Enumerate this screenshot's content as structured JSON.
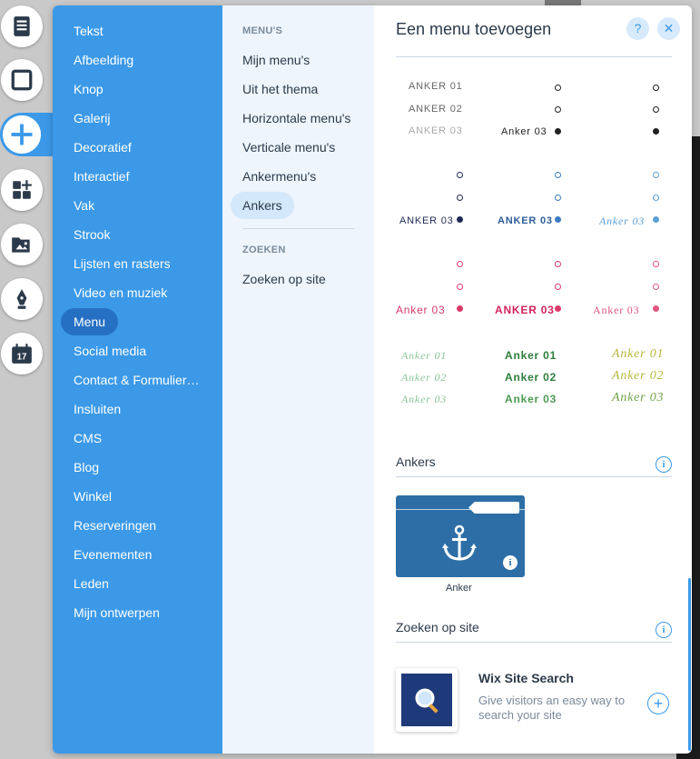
{
  "rail": {
    "items": [
      {
        "icon": "pages-icon"
      },
      {
        "icon": "frame-icon"
      },
      {
        "icon": "add-icon"
      },
      {
        "icon": "apps-icon"
      },
      {
        "icon": "media-icon"
      },
      {
        "icon": "pen-icon"
      },
      {
        "icon": "calendar-icon",
        "badge": "17"
      }
    ]
  },
  "categories": [
    {
      "label": "Tekst"
    },
    {
      "label": "Afbeelding"
    },
    {
      "label": "Knop"
    },
    {
      "label": "Galerij"
    },
    {
      "label": "Decoratief"
    },
    {
      "label": "Interactief"
    },
    {
      "label": "Vak"
    },
    {
      "label": "Strook"
    },
    {
      "label": "Lijsten en rasters"
    },
    {
      "label": "Video en muziek"
    },
    {
      "label": "Menu"
    },
    {
      "label": "Social media"
    },
    {
      "label": "Contact & Formulier…"
    },
    {
      "label": "Insluiten"
    },
    {
      "label": "CMS"
    },
    {
      "label": "Blog"
    },
    {
      "label": "Winkel"
    },
    {
      "label": "Reserveringen"
    },
    {
      "label": "Evenementen"
    },
    {
      "label": "Leden"
    },
    {
      "label": "Mijn ontwerpen"
    }
  ],
  "selected_category": "Menu",
  "submenu": {
    "section1": "MENU'S",
    "items": [
      {
        "label": "Mijn menu's"
      },
      {
        "label": "Uit het thema"
      },
      {
        "label": "Horizontale menu's"
      },
      {
        "label": "Verticale menu's"
      },
      {
        "label": "Ankermenu's"
      },
      {
        "label": "Ankers"
      }
    ],
    "section2": "ZOEKEN",
    "items2": [
      {
        "label": "Zoeken op site"
      }
    ]
  },
  "header": {
    "title": "Een menu toevoegen",
    "help": "?",
    "close": "✕"
  },
  "anchor_menus": {
    "row1": {
      "a1": "ANKER 01",
      "a2": "ANKER 02",
      "a3": "ANKER 03",
      "b3": "Anker 03"
    },
    "row2": {
      "a": "ANKER 03",
      "b": "ANKER 03",
      "c": "Anker 03"
    },
    "row3": {
      "a": "Anker 03",
      "b": "ANKER 03",
      "c": "Anker 03"
    },
    "row4": {
      "a": [
        "Anker 01",
        "Anker 02",
        "Anker 03"
      ],
      "b": [
        "Anker 01",
        "Anker 02",
        "Anker 03"
      ],
      "c": [
        "Anker 01",
        "Anker 02",
        "Anker 03"
      ]
    }
  },
  "ankers": {
    "title": "Ankers",
    "info": "i",
    "item_label": "Anker"
  },
  "search": {
    "title": "Zoeken op site",
    "info": "i",
    "app_title": "Wix Site Search",
    "app_desc": "Give visitors an easy way to search your site",
    "add": "+"
  },
  "colors": {
    "accent": "#3b99e8",
    "selected": "#2670c4",
    "navy": "#1e2a55",
    "pink": "#d93a6a",
    "green": "#2e7d3c"
  }
}
